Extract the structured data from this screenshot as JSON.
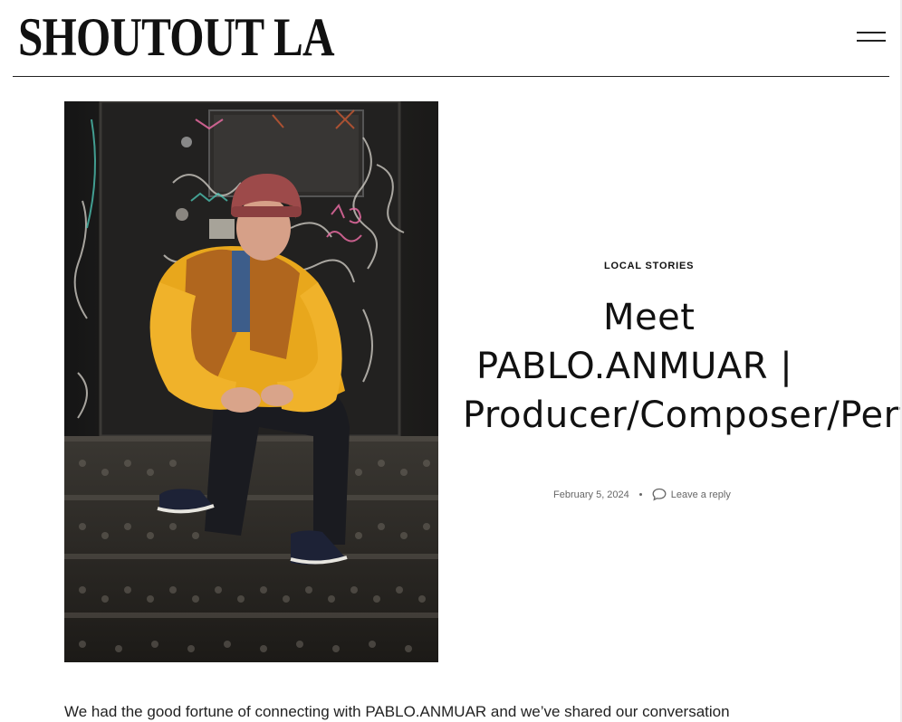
{
  "header": {
    "logo_text": "SHOUTOUT LA",
    "menu_icon": "hamburger-menu-icon"
  },
  "article": {
    "image_alt": "PABLO.ANMUAR",
    "category": "LOCAL STORIES",
    "title_line_1": "Meet",
    "title_line_2": "PABLO.ANMUAR |",
    "title_line_3": "Producer/Composer/Perf",
    "date": "February 5, 2024",
    "reply_icon": "comment-icon",
    "reply_label": "Leave a reply",
    "intro_text": "We had the good fortune of connecting with PABLO.ANMUAR and we’ve shared our conversation"
  },
  "colors": {
    "text": "#111111",
    "meta": "#666666",
    "jacket": "#e8a71c",
    "vest": "#b0661e"
  }
}
